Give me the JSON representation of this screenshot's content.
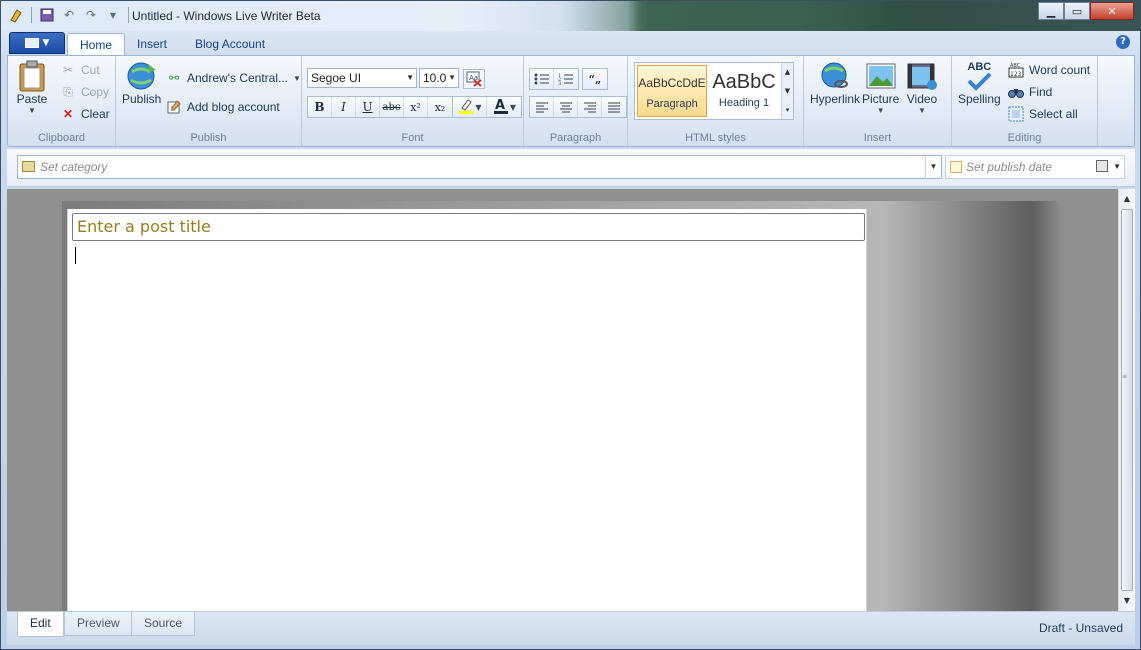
{
  "window": {
    "title": "Untitled - Windows Live Writer Beta"
  },
  "ribbon_tabs": [
    "Home",
    "Insert",
    "Blog Account"
  ],
  "clipboard": {
    "paste_label": "Paste",
    "cut_label": "Cut",
    "copy_label": "Copy",
    "clear_label": "Clear",
    "group_label": "Clipboard"
  },
  "publish": {
    "publish_label": "Publish",
    "account_label": "Andrew's Central...",
    "add_account_label": "Add blog account",
    "group_label": "Publish"
  },
  "font": {
    "family": "Segoe UI",
    "size": "10.0",
    "bold": "B",
    "italic": "I",
    "underline": "U",
    "strike": "abc",
    "superscript": "x²",
    "subscript": "x₂",
    "highlight_color": "#ffff00",
    "font_color": "#c00000",
    "group_label": "Font"
  },
  "paragraph": {
    "group_label": "Paragraph"
  },
  "html_styles": {
    "items": [
      {
        "sample": "AaBbCcDdE",
        "name": "Paragraph",
        "selected": true
      },
      {
        "sample": "AaBbC",
        "name": "Heading 1",
        "selected": false
      }
    ],
    "group_label": "HTML styles"
  },
  "insert": {
    "hyperlink_label": "Hyperlink",
    "picture_label": "Picture",
    "video_label": "Video",
    "group_label": "Insert"
  },
  "editing": {
    "spelling_label": "Spelling",
    "spelling_abc": "ABC",
    "word_count_label": "Word count",
    "find_label": "Find",
    "select_all_label": "Select all",
    "group_label": "Editing"
  },
  "category_bar": {
    "category_placeholder": "Set category",
    "publish_date_placeholder": "Set publish date"
  },
  "editor": {
    "title_placeholder": "Enter a post title"
  },
  "view_tabs": [
    "Edit",
    "Preview",
    "Source"
  ],
  "status": "Draft - Unsaved"
}
